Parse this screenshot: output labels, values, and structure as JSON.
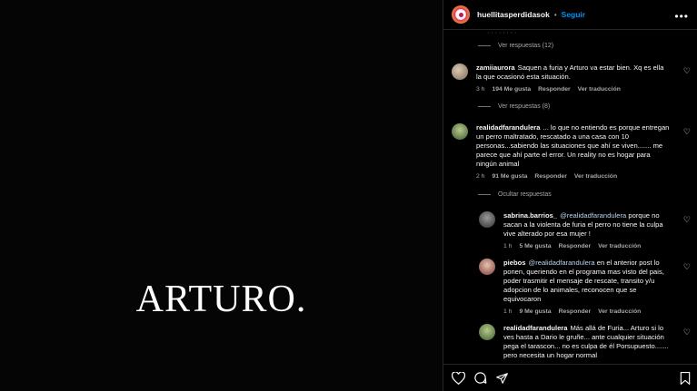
{
  "media": {
    "title": "ARTURO."
  },
  "header": {
    "username": "huellitasperdidasok",
    "separator": "•",
    "follow_label": "Seguir",
    "more_label": "•••"
  },
  "fade_text": "· · · · · · · ·",
  "reply_toggles": {
    "r1": "Ver respuestas (12)",
    "r2": "Ver respuestas (8)",
    "r3": "Ocultar respuestas"
  },
  "comments": [
    {
      "user": "zamiiaurora",
      "text": "Saquen a furia y Arturo va estar bien. Xq es ella la que ocasionó esta situación.",
      "time": "3 h",
      "likes": "194 Me gusta",
      "reply": "Responder",
      "translate": "Ver traducción"
    },
    {
      "user": "realidadfarandulera",
      "text": "... lo que no entiendo es porque entregan un perro maltratado, rescatado a una casa con 10 personas...sabiendo las situaciones que ahí se viven....... me parece que ahí parte el error. Un reality no es hogar para ningún animal",
      "time": "2 h",
      "likes": "91 Me gusta",
      "reply": "Responder",
      "translate": "Ver traducción"
    },
    {
      "user": "sabrina.barrios_",
      "mention": "@realidadfarandulera",
      "text": "porque no sacan a la violenta de furia el perro no tiene la culpa vive alterado por esa mujer !",
      "time": "1 h",
      "likes": "5 Me gusta",
      "reply": "Responder",
      "translate": "Ver traducción"
    },
    {
      "user": "piebos",
      "mention": "@realidadfarandulera",
      "text": "en el anterior post lo ponen, queriendo en el programa mas visto del pais, poder trasmitir el mensaje de rescate, transito y/u adopcion de lo animales, reconocen que se equivocaron",
      "time": "1 h",
      "likes": "9 Me gusta",
      "reply": "Responder",
      "translate": "Ver traducción"
    },
    {
      "user": "realidadfarandulera",
      "text": "Más allá de Furia... Arturo si lo ves hasta a Dario le gruñe... ante cualquier situación pega el tarascon... no es culpa de él Porsupuesto....... pero necesita un hogar normal"
    }
  ],
  "colors": {
    "accent": "#0095f6",
    "muted": "#a8a8a8",
    "background": "#000000"
  }
}
